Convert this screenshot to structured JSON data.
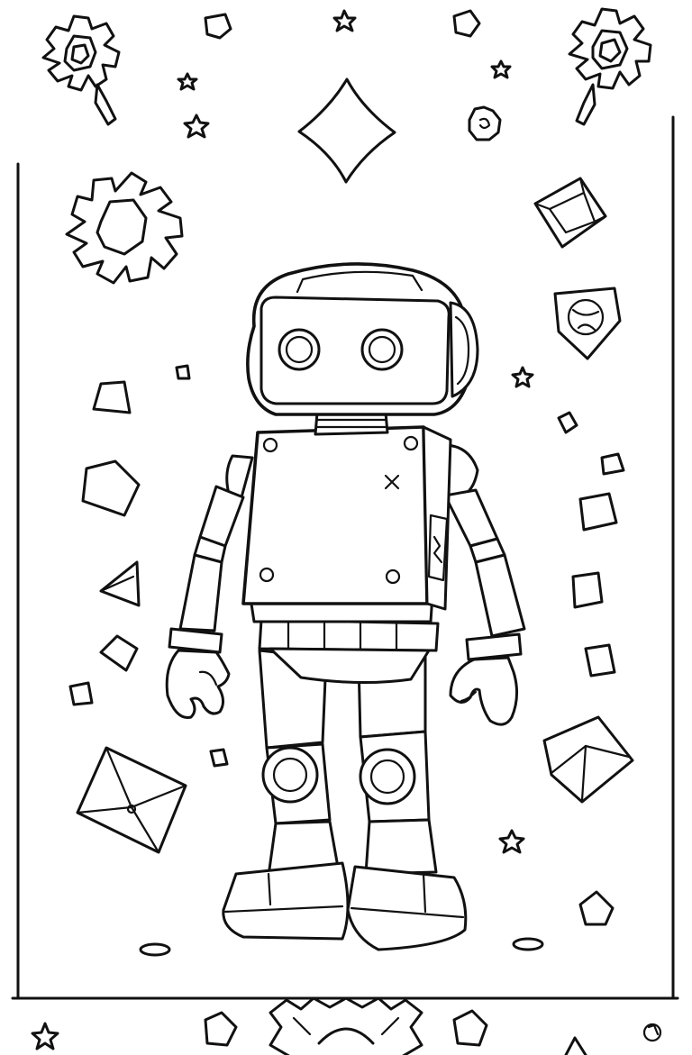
{
  "image": {
    "kind": "coloring page",
    "subject": "robot",
    "line_color": "#111111",
    "background_color": "#ffffff"
  },
  "icons": {
    "gear": "gear-icon",
    "star": "star-icon",
    "diamond": "diamond-icon",
    "gem": "gem-icon",
    "cube": "cube-icon",
    "triangle": "triangle-icon",
    "pyramid": "pyramid-icon"
  }
}
